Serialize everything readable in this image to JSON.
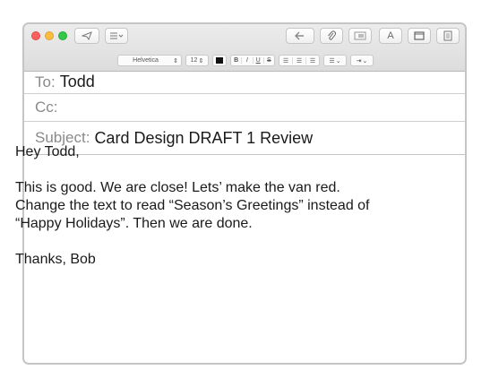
{
  "toolbar": {
    "font_name": "Helvetica",
    "font_size": "12",
    "bold_label": "B",
    "italic_label": "I",
    "underline_label": "U",
    "strike_label": "S",
    "font_button_label": "A",
    "icons": [
      "send-icon",
      "header-fields-icon",
      "reply-icon",
      "attachment-icon",
      "photo-browser-icon",
      "show-fonts-icon",
      "window-icon",
      "format-icon",
      "color-swatch-icon",
      "align-left-icon",
      "align-center-icon",
      "align-right-icon",
      "list-icon",
      "indent-icon"
    ]
  },
  "header": {
    "to_label": "To:",
    "to_value": "Todd",
    "cc_label": "Cc:",
    "cc_value": "",
    "subject_label": "Subject:",
    "subject_value": "Card Design DRAFT 1 Review"
  },
  "message": {
    "greeting": "Hey Todd,",
    "paragraph": "This is good.  We are close!  Lets’ make the van red.\nChange the text to read “Season’s Greetings” instead of\n“Happy Holidays”.  Then we are done.",
    "signoff": "Thanks, Bob"
  }
}
